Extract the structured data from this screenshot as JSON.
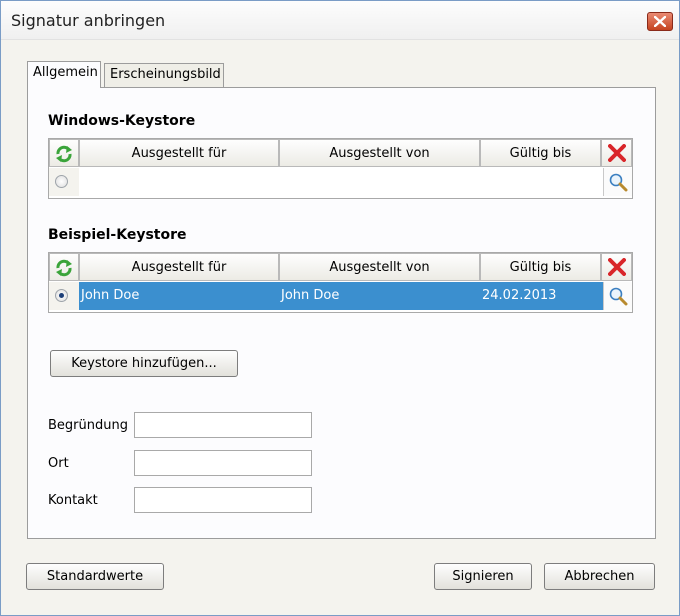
{
  "window": {
    "title": "Signatur anbringen"
  },
  "tabs": [
    {
      "label": "Allgemein",
      "active": true
    },
    {
      "label": "Erscheinungsbild",
      "active": false
    }
  ],
  "windows_keystore": {
    "title": "Windows-Keystore",
    "columns": [
      "Ausgestellt für",
      "Ausgestellt von",
      "Gültig bis"
    ],
    "rows": [
      {
        "issued_to": "",
        "issued_by": "",
        "valid_until": "",
        "selected": false
      }
    ]
  },
  "example_keystore": {
    "title": "Beispiel-Keystore",
    "columns": [
      "Ausgestellt für",
      "Ausgestellt von",
      "Gültig bis"
    ],
    "rows": [
      {
        "issued_to": "John Doe",
        "issued_by": "John Doe",
        "valid_until": "24.02.2013",
        "selected": true
      }
    ]
  },
  "add_keystore_label": "Keystore hinzufügen...",
  "fields": {
    "reason": {
      "label": "Begründung",
      "value": ""
    },
    "location": {
      "label": "Ort",
      "value": ""
    },
    "contact": {
      "label": "Kontakt",
      "value": ""
    }
  },
  "footer": {
    "defaults_label": "Standardwerte",
    "sign_label": "Signieren",
    "cancel_label": "Abbrechen"
  },
  "icons": {
    "refresh": "refresh-icon",
    "delete": "delete-icon",
    "view": "magnifier-icon",
    "close": "close-icon"
  },
  "colors": {
    "selection": "#3b8fcf",
    "refresh_green": "#3aa43a",
    "delete_red": "#d9262a",
    "close_red": "#c5421f"
  }
}
